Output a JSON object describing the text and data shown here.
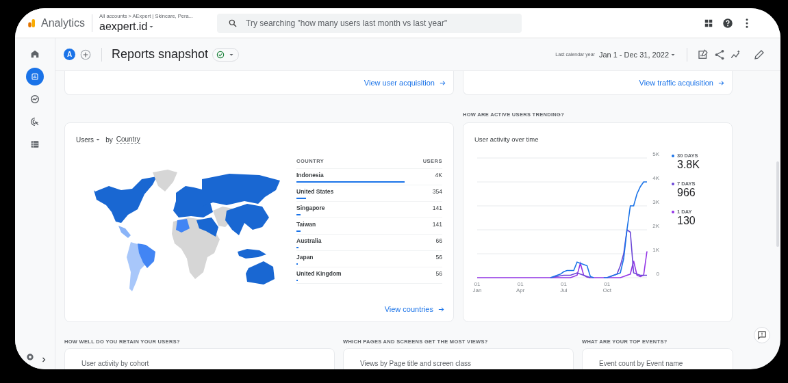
{
  "header": {
    "product": "Analytics",
    "breadcrumb": "All accounts > AExpert | Skincare, Pera...",
    "property": "aexpert.id",
    "search": {
      "placeholder": "Try searching \"how many users last month vs last year\""
    }
  },
  "sidebar": {
    "items": [
      {
        "kind": "home",
        "selected": false
      },
      {
        "kind": "reports",
        "selected": true
      },
      {
        "kind": "explore",
        "selected": false
      },
      {
        "kind": "advertising",
        "selected": false
      },
      {
        "kind": "configure",
        "selected": false
      }
    ]
  },
  "toolbar": {
    "avatar": "A",
    "title": "Reports snapshot",
    "range_label": "Last calendar year",
    "range": "Jan 1 - Dec 31, 2022"
  },
  "top_cards": [
    {
      "link": "View user acquisition"
    },
    {
      "link": "View traffic acquisition"
    }
  ],
  "trend_heading": "HOW ARE ACTIVE USERS TRENDING?",
  "country_card": {
    "metric": "Users",
    "by": "by",
    "dimension": "Country",
    "columns": [
      "COUNTRY",
      "USERS"
    ],
    "rows": [
      {
        "country": "Indonesia",
        "users": "4K",
        "level": 0.74
      },
      {
        "country": "United States",
        "users": "354",
        "level": 0.065
      },
      {
        "country": "Singapore",
        "users": "141",
        "level": 0.026
      },
      {
        "country": "Taiwan",
        "users": "141",
        "level": 0.026
      },
      {
        "country": "Australia",
        "users": "66",
        "level": 0.012
      },
      {
        "country": "Japan",
        "users": "56",
        "level": 0.01
      },
      {
        "country": "United Kingdom",
        "users": "56",
        "level": 0.01
      }
    ],
    "link": "View countries"
  },
  "activity_card": {
    "totals": [
      "3.8K",
      "966",
      "130"
    ],
    "chart_data": {
      "type": "line",
      "title": "User activity over time",
      "ylim": [
        0,
        5000
      ],
      "grid": true,
      "categories": [
        "01 Jan",
        null,
        null,
        null,
        null,
        null,
        null,
        null,
        null,
        null,
        null,
        null,
        null,
        "01 Apr",
        null,
        null,
        null,
        null,
        null,
        null,
        null,
        null,
        null,
        null,
        null,
        null,
        "01 Jul",
        null,
        null,
        null,
        null,
        null,
        null,
        null,
        null,
        null,
        null,
        null,
        null,
        "01 Oct",
        null,
        null,
        null,
        null,
        null,
        null,
        null,
        null,
        null,
        null,
        null,
        null
      ],
      "yticks": [
        {
          "value": 0,
          "label": "0"
        },
        {
          "value": 1000,
          "label": "1K"
        },
        {
          "value": 2000,
          "label": "2K"
        },
        {
          "value": 3000,
          "label": "3K"
        },
        {
          "value": 4000,
          "label": "4K"
        },
        {
          "value": 5000,
          "label": "5K"
        }
      ],
      "series": [
        {
          "name": "30 DAYS",
          "color": "#1a73e8",
          "values": [
            null,
            null,
            null,
            null,
            null,
            null,
            null,
            null,
            null,
            null,
            null,
            null,
            null,
            null,
            null,
            null,
            null,
            null,
            null,
            null,
            null,
            null,
            0,
            50,
            100,
            150,
            250,
            300,
            300,
            300,
            650,
            600,
            550,
            500,
            50,
            0,
            null,
            null,
            0,
            0,
            50,
            100,
            150,
            200,
            800,
            2000,
            3000,
            3000,
            3500,
            3800,
            4000,
            4000
          ]
        },
        {
          "name": "7 DAYS",
          "color": "#6b46d6",
          "values": [
            null,
            null,
            null,
            null,
            null,
            null,
            null,
            null,
            null,
            null,
            null,
            null,
            null,
            null,
            null,
            null,
            null,
            null,
            null,
            null,
            null,
            null,
            0,
            20,
            50,
            80,
            100,
            100,
            100,
            150,
            200,
            150,
            100,
            50,
            0,
            null,
            null,
            null,
            null,
            0,
            50,
            100,
            150,
            500,
            1000,
            2000,
            1900,
            200,
            150,
            100,
            100,
            100
          ]
        },
        {
          "name": "1 DAY",
          "color": "#9334e6",
          "values": [
            0,
            0,
            0,
            0,
            0,
            0,
            0,
            0,
            0,
            0,
            0,
            0,
            0,
            0,
            0,
            0,
            0,
            0,
            0,
            0,
            0,
            0,
            0,
            0,
            0,
            0,
            0,
            0,
            0,
            50,
            100,
            600,
            100,
            20,
            0,
            0,
            0,
            0,
            0,
            0,
            0,
            0,
            0,
            0,
            50,
            100,
            150,
            700,
            100,
            50,
            100,
            1100
          ]
        }
      ]
    }
  },
  "bottom_sections": [
    {
      "heading": "HOW WELL DO YOU RETAIN YOUR USERS?",
      "card_title": "User activity by cohort"
    },
    {
      "heading": "WHICH PAGES AND SCREENS GET THE MOST VIEWS?",
      "card_title": "Views by Page title and screen class"
    },
    {
      "heading": "WHAT ARE YOUR TOP EVENTS?",
      "card_title": "Event count by Event name"
    }
  ]
}
